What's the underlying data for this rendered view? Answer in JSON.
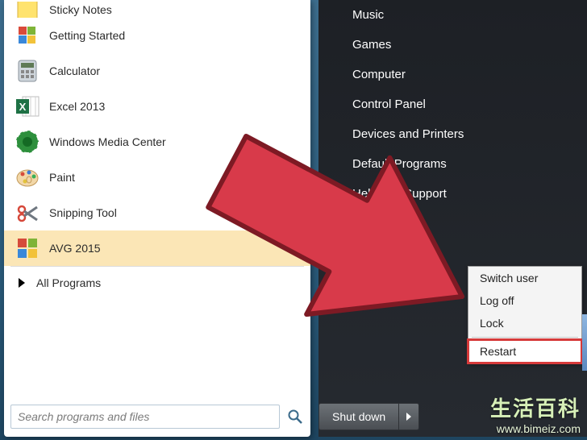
{
  "programs": [
    {
      "label": "Sticky Notes",
      "icon": "sticky"
    },
    {
      "label": "Getting Started",
      "icon": "flag"
    },
    {
      "label": "Calculator",
      "icon": "calc"
    },
    {
      "label": "Excel 2013",
      "icon": "excel"
    },
    {
      "label": "Windows Media Center",
      "icon": "wmc"
    },
    {
      "label": "Paint",
      "icon": "paint"
    },
    {
      "label": "Snipping Tool",
      "icon": "snip"
    },
    {
      "label": "AVG 2015",
      "icon": "avg",
      "highlight": true
    }
  ],
  "all_programs_label": "All Programs",
  "search": {
    "placeholder": "Search programs and files"
  },
  "right_items": [
    "Music",
    "Games",
    "Computer",
    "Control Panel",
    "Devices and Printers",
    "Default Programs",
    "Help and Support"
  ],
  "shutdown": {
    "label": "Shut down"
  },
  "power_menu": [
    "Switch user",
    "Log off",
    "Lock",
    "Restart"
  ],
  "power_menu_sep_after": 2,
  "power_menu_highlight": 3,
  "watermark": {
    "line1": "生活百科",
    "line2": "www.bimeiz.com"
  },
  "arrow_color": "#d83a4a",
  "arrow_stroke": "#7d1a24"
}
